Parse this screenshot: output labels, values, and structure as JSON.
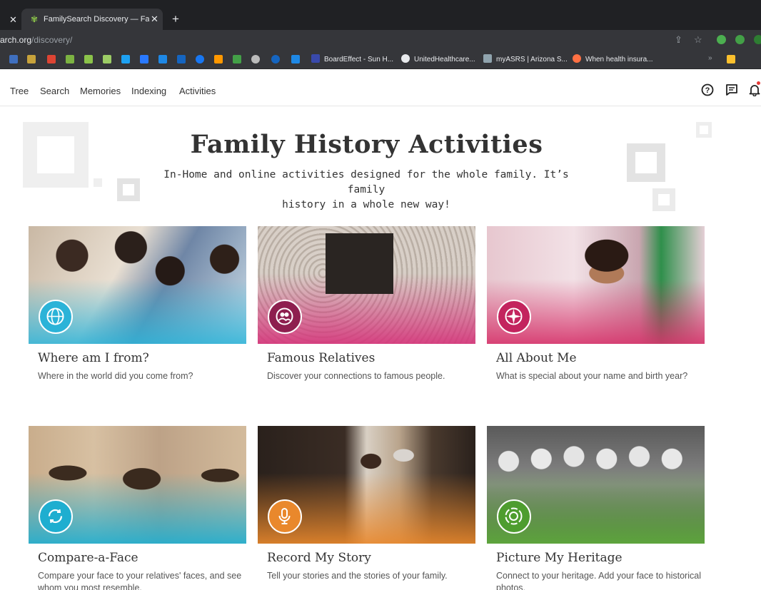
{
  "browser": {
    "tab_title": "FamilySearch Discovery — Family",
    "url_host": "arch.org",
    "url_path": "/discovery/",
    "bookmarks": [
      "BoardEffect - Sun H...",
      "UnitedHealthcare...",
      "myASRS | Arizona S...",
      "When health insura..."
    ],
    "bookmarks_overflow": "»"
  },
  "nav": {
    "items": [
      "Tree",
      "Search",
      "Memories",
      "Indexing",
      "Activities"
    ]
  },
  "hero": {
    "title": "Family History Activities",
    "subtitle_line1": "In-Home and online activities designed for the whole family. It’s family",
    "subtitle_line2": "history in a whole new way!"
  },
  "cards": [
    {
      "title": "Where am I from?",
      "desc": "Where in the world did you come from?",
      "color": "#2bb3d8",
      "icon": "globe-icon"
    },
    {
      "title": "Famous Relatives",
      "desc": "Discover your connections to famous people.",
      "color": "#d6337a",
      "icon": "people-icon"
    },
    {
      "title": "All About Me",
      "desc": "What is special about your name and birth year?",
      "color": "#d6336b",
      "icon": "compass-icon"
    },
    {
      "title": "Compare-a-Face",
      "desc": "Compare your face to your relatives' faces, and see whom you most resemble.",
      "color": "#1eaed0",
      "icon": "face-compare-icon"
    },
    {
      "title": "Record My Story",
      "desc": "Tell your stories and the stories of your family.",
      "color": "#e9882c",
      "icon": "microphone-icon"
    },
    {
      "title": "Picture My Heritage",
      "desc": "Connect to your heritage. Add your face to historical photos.",
      "color": "#5fae3b",
      "icon": "camera-frame-icon"
    }
  ]
}
